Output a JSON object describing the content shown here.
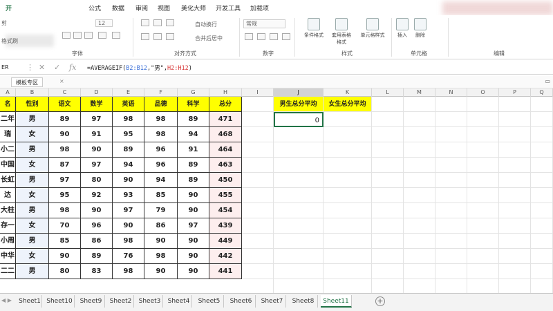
{
  "menu": {
    "items": [
      "开",
      "公式",
      "数据",
      "审阅",
      "视图",
      "美化大师",
      "开发工具",
      "加载项"
    ]
  },
  "ribbon": {
    "font_size": "12",
    "groups": [
      "字体",
      "对齐方式",
      "数字",
      "样式",
      "单元格",
      "编辑"
    ],
    "wrap_text": "自动换行",
    "merge_center": "合并后居中",
    "number_format": "常规",
    "conditional_format": "条件格式",
    "table_format": "套用表格格式",
    "cell_style": "单元格样式",
    "insert": "插入",
    "delete": "删除",
    "format_painter": "格式刷",
    "cut": "剪"
  },
  "formula_bar": {
    "name_box": "ER",
    "fx": "fx",
    "formula_prefix": "=AVERAGEIF(",
    "formula_ref1": "B2:B12",
    "formula_mid": ",\"男\",",
    "formula_ref2": "H2:H12",
    "formula_suffix": ")"
  },
  "template_tab": {
    "label": "模板专区",
    "close": "×"
  },
  "columns": [
    "A",
    "B",
    "C",
    "D",
    "E",
    "F",
    "G",
    "H",
    "I",
    "J",
    "K",
    "L",
    "M",
    "N",
    "O",
    "P",
    "Q"
  ],
  "table": {
    "headers": [
      "名",
      "性别",
      "语文",
      "数学",
      "英语",
      "品德",
      "科学",
      "总分"
    ],
    "rows": [
      [
        "二年",
        "男",
        "89",
        "97",
        "98",
        "98",
        "89",
        "471"
      ],
      [
        "瑞",
        "女",
        "90",
        "91",
        "95",
        "98",
        "94",
        "468"
      ],
      [
        "小二",
        "男",
        "98",
        "90",
        "89",
        "96",
        "91",
        "464"
      ],
      [
        "中国",
        "女",
        "87",
        "97",
        "94",
        "96",
        "89",
        "463"
      ],
      [
        "长虹",
        "男",
        "97",
        "80",
        "90",
        "94",
        "89",
        "450"
      ],
      [
        "达",
        "女",
        "95",
        "92",
        "93",
        "85",
        "90",
        "455"
      ],
      [
        "大柱",
        "男",
        "98",
        "90",
        "97",
        "79",
        "90",
        "454"
      ],
      [
        "存一",
        "女",
        "70",
        "96",
        "90",
        "86",
        "97",
        "439"
      ],
      [
        "小周",
        "男",
        "85",
        "86",
        "98",
        "90",
        "90",
        "449"
      ],
      [
        "中华",
        "女",
        "90",
        "89",
        "76",
        "98",
        "90",
        "442"
      ],
      [
        "二二",
        "男",
        "80",
        "83",
        "98",
        "90",
        "90",
        "441"
      ]
    ]
  },
  "summary": {
    "male_avg_label": "男生总分平均",
    "female_avg_label": "女生总分平均",
    "male_avg_value": "0"
  },
  "sheets": [
    "Sheet1",
    "Sheet10",
    "Sheet9",
    "Sheet2",
    "Sheet3",
    "Sheet4",
    "Sheet5",
    "Sheet6",
    "Sheet7",
    "Sheet8",
    "Sheet11"
  ],
  "active_sheet": "Sheet11",
  "add_sheet": "+",
  "colors": {
    "header_yellow": "#ffff00",
    "active_green": "#217346"
  }
}
